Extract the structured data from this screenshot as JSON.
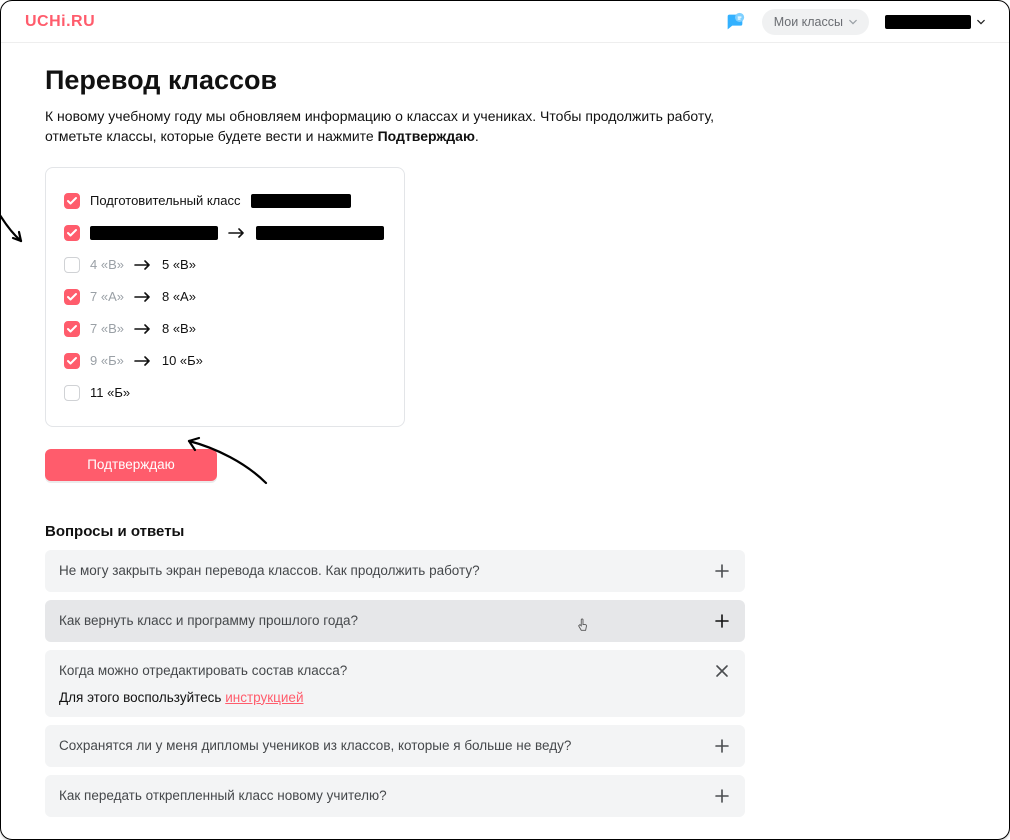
{
  "header": {
    "logo": "UCHi.RU",
    "my_classes": "Мои классы"
  },
  "page": {
    "title": "Перевод классов",
    "intro_1": "К новому учебному году мы обновляем информацию о классах и учениках. Чтобы продолжить работу, отметьте классы, которые будете вести и нажмите ",
    "intro_bold": "Подтверждаю",
    "intro_2": "."
  },
  "classes": [
    {
      "checked": true,
      "from_label": "Подготовительный класс",
      "to_label": "",
      "from_redacted_w": 0,
      "to_redacted_w": 100,
      "show_arrow": false,
      "muted": false
    },
    {
      "checked": true,
      "from_label": "",
      "to_label": "",
      "from_redacted_w": 128,
      "to_redacted_w": 128,
      "show_arrow": true,
      "muted": false
    },
    {
      "checked": false,
      "from_label": "4 «В»",
      "to_label": "5 «В»",
      "from_redacted_w": 0,
      "to_redacted_w": 0,
      "show_arrow": true,
      "muted": true
    },
    {
      "checked": true,
      "from_label": "7 «А»",
      "to_label": "8 «А»",
      "from_redacted_w": 0,
      "to_redacted_w": 0,
      "show_arrow": true,
      "muted": true
    },
    {
      "checked": true,
      "from_label": "7 «В»",
      "to_label": "8 «В»",
      "from_redacted_w": 0,
      "to_redacted_w": 0,
      "show_arrow": true,
      "muted": true
    },
    {
      "checked": true,
      "from_label": "9 «Б»",
      "to_label": "10 «Б»",
      "from_redacted_w": 0,
      "to_redacted_w": 0,
      "show_arrow": true,
      "muted": true
    },
    {
      "checked": false,
      "from_label": "11 «Б»",
      "to_label": "",
      "from_redacted_w": 0,
      "to_redacted_w": 0,
      "show_arrow": false,
      "muted": false
    }
  ],
  "confirm_label": "Подтверждаю",
  "faq": {
    "title": "Вопросы и ответы",
    "items": [
      {
        "q": "Не могу закрыть экран перевода классов. Как продолжить работу?",
        "state": "plus"
      },
      {
        "q": "Как вернуть класс и программу прошлого года?",
        "state": "plus",
        "hover": true
      },
      {
        "q": "Когда можно отредактировать состав класса?",
        "state": "open",
        "body_prefix": "Для этого воспользуйтесь ",
        "body_link": "инструкцией"
      },
      {
        "q": "Сохранятся ли у меня дипломы учеников из классов, которые я больше не веду?",
        "state": "plus"
      },
      {
        "q": "Как передать открепленный класс новому учителю?",
        "state": "plus"
      }
    ]
  }
}
